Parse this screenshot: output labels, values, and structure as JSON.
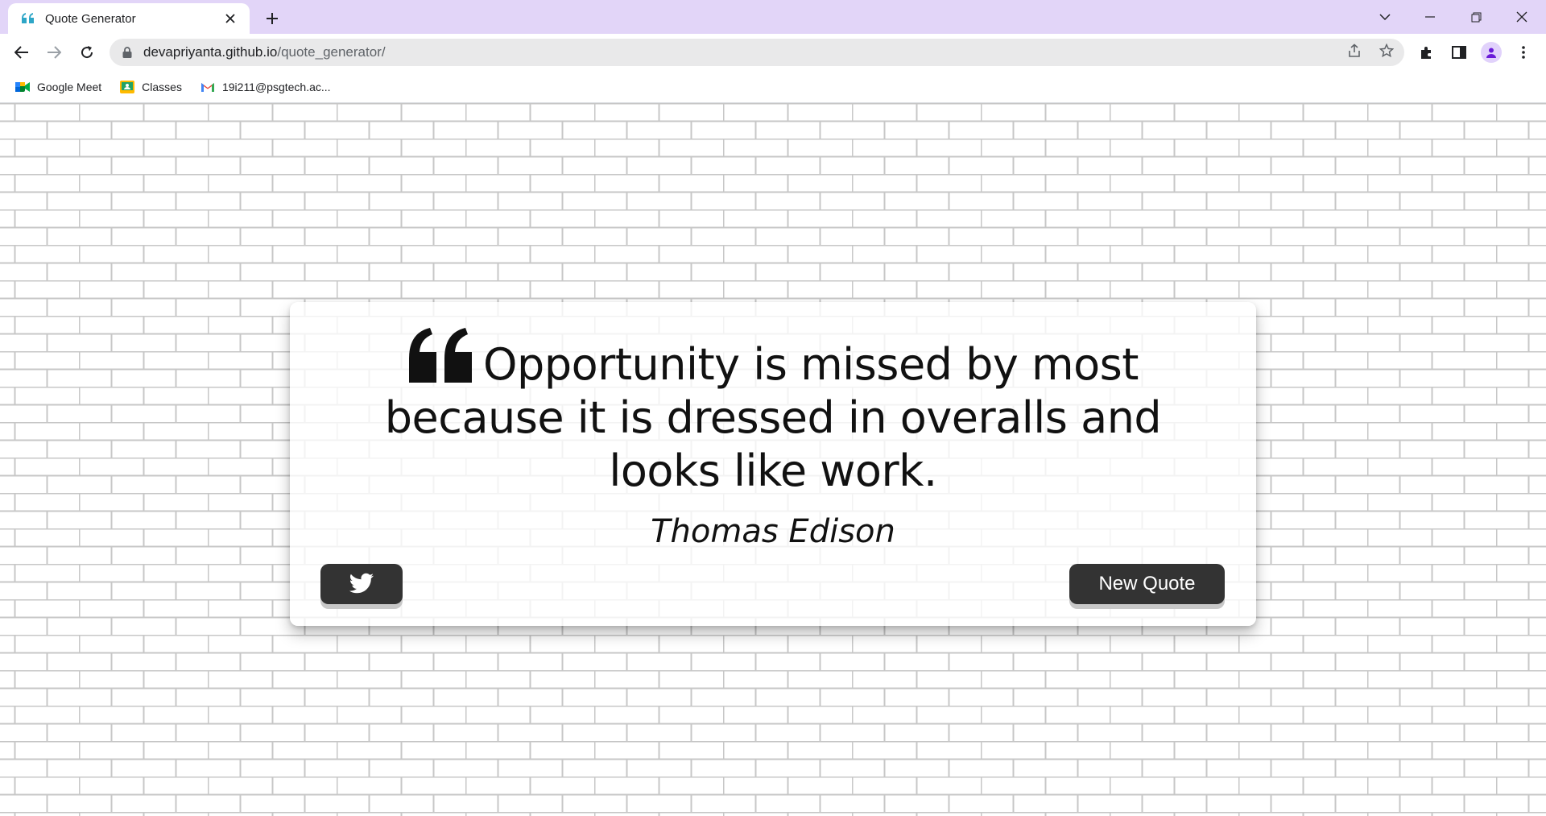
{
  "browser": {
    "tab_title": "Quote Generator",
    "url_host": "devapriyanta.github.io",
    "url_path": "/quote_generator/",
    "bookmarks": [
      {
        "label": "Google Meet",
        "icon": "google-meet-icon"
      },
      {
        "label": "Classes",
        "icon": "google-classroom-icon"
      },
      {
        "label": "19i211@psgtech.ac...",
        "icon": "gmail-icon"
      }
    ],
    "colors": {
      "tabstrip": "#e2d5f8",
      "favicon": "#2ea6c7"
    }
  },
  "quote": {
    "text": "Opportunity is missed by most because it is dressed in overalls and looks like work.",
    "author": "Thomas Edison"
  },
  "buttons": {
    "tweet_icon": "twitter-icon",
    "new_quote_label": "New Quote"
  },
  "colors": {
    "button_bg": "#333333",
    "button_text": "#ffffff",
    "brick_line": "#c9c9c9"
  }
}
